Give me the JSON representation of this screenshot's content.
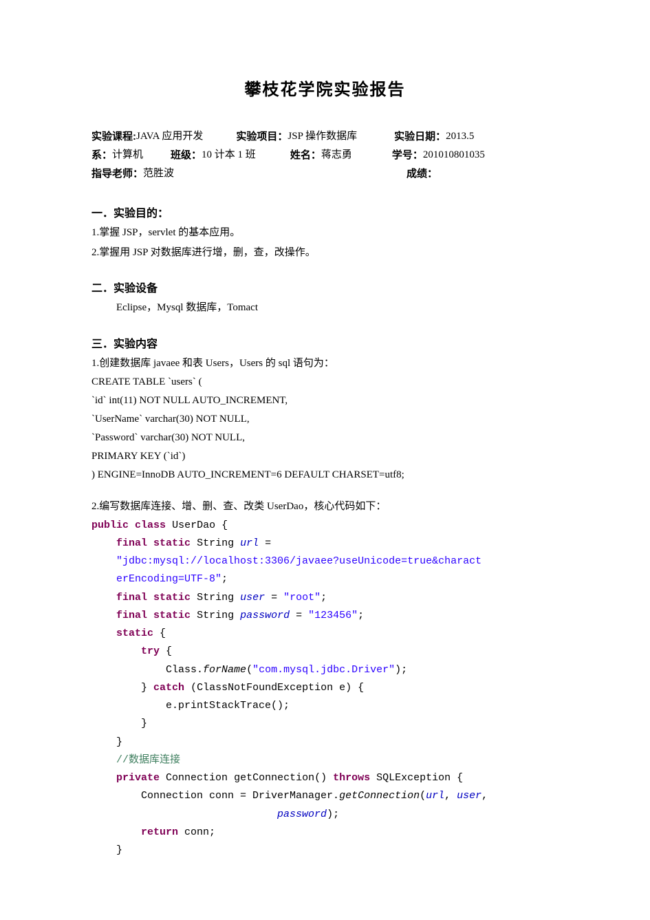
{
  "title": "攀枝花学院实验报告",
  "meta": {
    "row1": {
      "course_label": "实验课程:",
      "course_value": "JAVA 应用开发",
      "project_label": "实验项目：",
      "project_value": "JSP 操作数据库",
      "date_label": "实验日期：",
      "date_value": "2013.5"
    },
    "row2": {
      "dept_label": "系：",
      "dept_value": "计算机",
      "class_label": "班级：",
      "class_value": "10 计本 1 班",
      "name_label": "姓名：",
      "name_value": "蒋志勇",
      "sid_label": "学号：",
      "sid_value": "201010801035"
    },
    "row3": {
      "teacher_label": "指导老师：",
      "teacher_value": "范胜波",
      "grade_label": "成绩："
    }
  },
  "sections": {
    "s1": {
      "h": "一．实验目的：",
      "l1": "1.掌握 JSP，servlet 的基本应用。",
      "l2": "2.掌握用 JSP 对数据库进行增，删，查，改操作。"
    },
    "s2": {
      "h": "二．实验设备",
      "l1": "Eclipse，Mysql 数据库，Tomact"
    },
    "s3": {
      "h": "三．实验内容",
      "p1": "1.创建数据库 javaee 和表 Users，Users 的 sql 语句为：",
      "sql": {
        "l1": "CREATE  TABLE  `users`  (",
        "l2": "  `id`  int(11)  NOT  NULL  AUTO_INCREMENT,",
        "l3": "  `UserName`  varchar(30)  NOT  NULL,",
        "l4": "  `Password`  varchar(30)  NOT  NULL,",
        "l5": "  PRIMARY  KEY  (`id`)",
        "l6": ")  ENGINE=InnoDB  AUTO_INCREMENT=6  DEFAULT  CHARSET=utf8;"
      },
      "p2": "2.编写数据库连接、增、删、查、改类 UserDao，核心代码如下：",
      "code": {
        "kw_public": "public",
        "kw_class": "class",
        "cls_name": "UserDao {",
        "kw_final": "final",
        "kw_static": "static",
        "ty_string": "String",
        "var_url": "url",
        "eq": " = ",
        "str_url1": "\"jdbc:mysql://localhost:3306/javaee?useUnicode=true&charact",
        "str_url2": "erEncoding=UTF-8\"",
        "semi": ";",
        "var_user": "user",
        "str_user": "\"root\"",
        "var_password": "password",
        "str_password": "\"123456\"",
        "kw_try": "try",
        "brace_open": " {",
        "m_forName": "forName",
        "str_driver": "\"com.mysql.jdbc.Driver\"",
        "cls_Class": "Class.",
        "paren_close": ");",
        "brace_close": "}",
        "kw_catch": "catch",
        "ex": " (ClassNotFoundException e) {",
        "stack": "e.printStackTrace();",
        "comment_conn": "//数据库连接",
        "kw_private": "private",
        "ty_conn": "Connection",
        "m_getConn": " getConnection() ",
        "kw_throws": "throws",
        "ty_sqlex": " SQLException {",
        "conn_decl": "Connection conn = DriverManager.",
        "m_getConnection": "getConnection",
        "args_open": "(",
        "comma1": ", ",
        "kw_return": "return",
        "ret_conn": " conn;"
      }
    }
  }
}
